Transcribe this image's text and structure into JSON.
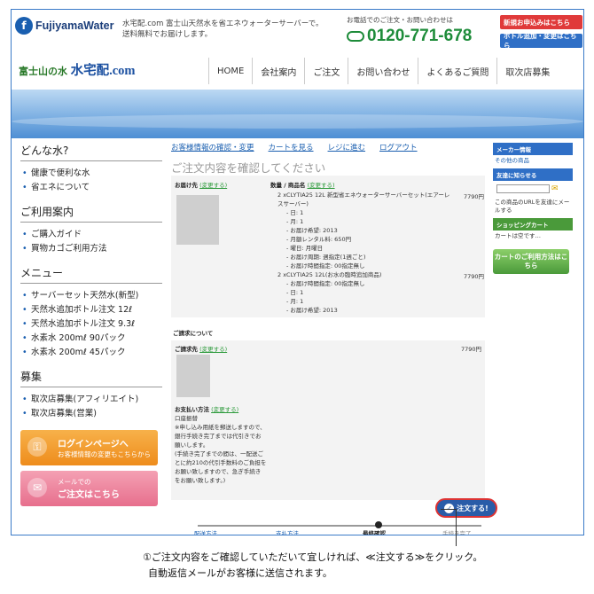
{
  "header": {
    "logo_text": "FujiyamaWater",
    "intro_line1": "水宅配.com 富士山天然水を省エネウォーターサーバーで。",
    "intro_line2": "送料無料でお届けします。",
    "phone_label": "お電話でのご注文・お問い合わせは",
    "phone": "0120-771-678",
    "btn_new": "新規お申込みはこちら",
    "btn_add": "ボトル追加・変更はこちら"
  },
  "brand": {
    "small": "富士山の水",
    "main": "水宅配.com"
  },
  "nav": [
    "HOME",
    "会社案内",
    "ご注文",
    "お問い合わせ",
    "よくあるご質問",
    "取次店募集"
  ],
  "sidebar": {
    "sec1_title": "どんな水?",
    "sec1_items": [
      "健康で便利な水",
      "省エネについて"
    ],
    "sec2_title": "ご利用案内",
    "sec2_items": [
      "ご購入ガイド",
      "買物カゴご利用方法"
    ],
    "sec3_title": "メニュー",
    "sec3_items": [
      "サーバーセット天然水(新型)",
      "天然水追加ボトル注文 12ℓ",
      "天然水追加ボトル注文 9.3ℓ",
      "水素水 200mℓ 90パック",
      "水素水 200mℓ 45パック"
    ],
    "sec4_title": "募集",
    "sec4_items": [
      "取次店募集(アフィリエイト)",
      "取次店募集(営業)"
    ],
    "login_t1": "ログインページへ",
    "login_t2": "お客様情報の変更もこちらから",
    "mail_t1": "メールでの",
    "mail_t2": "ご注文はこちら"
  },
  "main": {
    "steps": [
      "お客様情報の確認・変更",
      "カートを見る",
      "レジに進む",
      "ログアウト"
    ],
    "title": "ご注文内容を確認してください",
    "delivery_label": "お届け先",
    "change": "(変更する)",
    "qty_label": "数量 / 商品名",
    "item1": "2 xCLYTIA25 12L 新型省エネウォーターサーバーセット(エアーレスサーバー)",
    "item1_price": "7790円",
    "item1_details": [
      "- 日: 1",
      "- 月: 1",
      "- お届け希望: 2013",
      "- 月額レンタル料: 650円",
      "- 曜日: 月曜日",
      "- お届け周期: 週指定(1週ごと)",
      "- お届け時間指定: 00指定無し"
    ],
    "item2": "2 xCLYTIA25 12L(お水の臨時追加商品)",
    "item2_price": "7790円",
    "item2_details": [
      "- お届け時間指定: 00指定無し",
      "- 日: 1",
      "- 月: 1",
      "- お届け希望: 2013"
    ],
    "billing_about": "ご請求について",
    "billing_label": "ご請求先",
    "billing_price": "7790円",
    "payment_label": "お支払い方法",
    "payment_lines": [
      "口座振替",
      "※申し込み用紙を郵送しますので、",
      "銀行手続き完了までは代引きでお",
      "願いします。",
      "(手続き完了までの間は、一配送ご",
      "とに約210の代引手数料のご負担を",
      "お願い致しますので、急ぎ手続き",
      "をお願い致します。)"
    ],
    "order_btn": "注文する!",
    "progress": [
      "配送方法",
      "支払方法",
      "最終確認",
      "手続き完了"
    ]
  },
  "right": {
    "member_head": "メーカー情報",
    "other": "その他の商品",
    "friend_head": "友達に知らせる",
    "friend_text": "この商品のURLを友達にメールする",
    "cart_head": "ショッピングカート",
    "cart_text": "カートは空です…",
    "calendar": "カートのご利用方法はこちら"
  },
  "annotation": {
    "line1": "①ご注文内容をご確認していただいて宜しければ、≪注文する≫をクリック。",
    "line2": "自動返信メールがお客様に送信されます。"
  }
}
